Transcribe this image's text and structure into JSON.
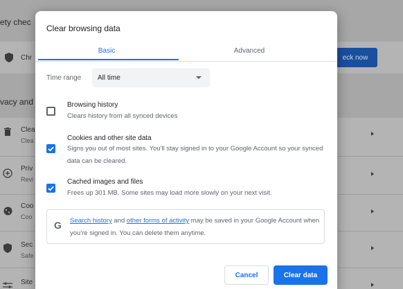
{
  "background": {
    "heading_safety": "ety chec",
    "safety_row_title": "Chr",
    "check_now_label": "eck now",
    "heading_privacy": "vacy and",
    "rows": [
      {
        "icon": "trash-icon",
        "title": "Clea",
        "sub": "Clea"
      },
      {
        "icon": "globe-icon",
        "title": "Priv",
        "sub": "Revi"
      },
      {
        "icon": "cookie-icon",
        "title": "Coo",
        "sub": "Coo"
      },
      {
        "icon": "shield-icon",
        "title": "Sec",
        "sub": "Safe"
      },
      {
        "icon": "sliders-icon",
        "title": "Site",
        "sub": ""
      }
    ]
  },
  "dialog": {
    "title": "Clear browsing data",
    "tabs": [
      {
        "label": "Basic",
        "active": true
      },
      {
        "label": "Advanced",
        "active": false
      }
    ],
    "time_range": {
      "label": "Time range",
      "value": "All time"
    },
    "options": [
      {
        "title": "Browsing history",
        "description": "Clears history from all synced devices",
        "checked": false
      },
      {
        "title": "Cookies and other site data",
        "description": "Signs you out of most sites. You'll stay signed in to your Google Account so your synced data can be cleared.",
        "checked": true
      },
      {
        "title": "Cached images and files",
        "description": "Frees up 301 MB. Some sites may load more slowly on your next visit.",
        "checked": true
      }
    ],
    "info": {
      "link1": "Search history",
      "mid": " and ",
      "link2": "other forms of activity",
      "rest": " may be saved in your Google Account when you're signed in. You can delete them anytime."
    },
    "buttons": {
      "cancel": "Cancel",
      "clear": "Clear data"
    }
  },
  "colors": {
    "accent": "#1a73e8",
    "overlay": "#a7a7a7"
  }
}
